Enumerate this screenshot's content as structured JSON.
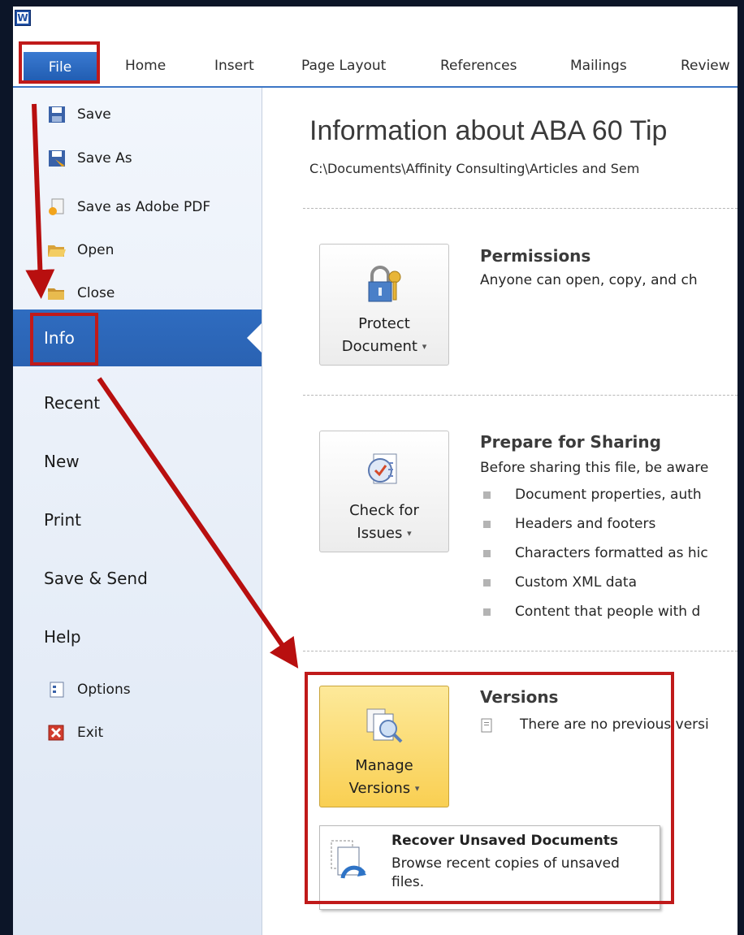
{
  "ribbon": {
    "app_icon_letter": "W",
    "tabs": [
      "File",
      "Home",
      "Insert",
      "Page Layout",
      "References",
      "Mailings",
      "Review"
    ]
  },
  "backstage_nav": {
    "commands": [
      {
        "label": "Save",
        "icon": "save-icon"
      },
      {
        "label": "Save As",
        "icon": "save-as-icon"
      },
      {
        "label": "Save as Adobe PDF",
        "icon": "pdf-icon"
      },
      {
        "label": "Open",
        "icon": "open-folder-icon"
      },
      {
        "label": "Close",
        "icon": "close-folder-icon"
      }
    ],
    "selected": "Info",
    "sections": [
      "Recent",
      "New",
      "Print",
      "Save & Send",
      "Help"
    ],
    "footer": [
      {
        "label": "Options",
        "icon": "options-icon"
      },
      {
        "label": "Exit",
        "icon": "exit-icon"
      }
    ]
  },
  "info": {
    "title": "Information about ABA 60 Tip",
    "path": "C:\\Documents\\Affinity Consulting\\Articles and Sem",
    "permissions": {
      "button_line1": "Protect",
      "button_line2": "Document",
      "title": "Permissions",
      "text": "Anyone can open, copy, and ch"
    },
    "prepare": {
      "button_line1": "Check for",
      "button_line2": "Issues",
      "title": "Prepare for Sharing",
      "text": "Before sharing this file, be aware",
      "bullets": [
        "Document properties, auth",
        "Headers and footers",
        "Characters formatted as hic",
        "Custom XML data",
        "Content that people with d"
      ]
    },
    "versions": {
      "button_line1": "Manage",
      "button_line2": "Versions",
      "title": "Versions",
      "text": "There are no previous versi",
      "menu_item": {
        "title": "Recover Unsaved Documents",
        "description": "Browse recent copies of unsaved files."
      }
    }
  },
  "colors": {
    "highlight_box": "#c01a1a",
    "selected_nav": "#2f6cc0",
    "active_button": "#f9cf52"
  }
}
